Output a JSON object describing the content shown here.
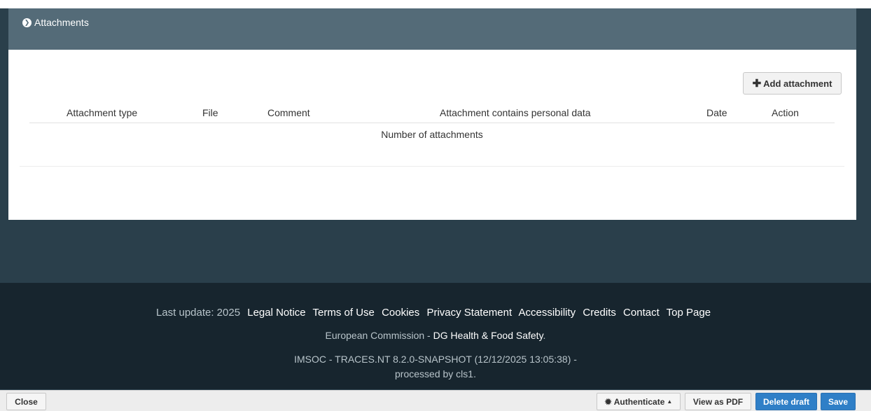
{
  "section": {
    "title": "Attachments"
  },
  "attachments": {
    "add_button_label": "Add attachment",
    "columns": [
      "Attachment type",
      "File",
      "Comment",
      "Attachment contains personal data",
      "Date",
      "Action"
    ],
    "summary_label": "Number of attachments"
  },
  "footer": {
    "last_update": "Last update: 2025",
    "links": [
      "Legal Notice",
      "Terms of Use",
      "Cookies",
      "Privacy Statement",
      "Accessibility",
      "Credits",
      "Contact",
      "Top Page"
    ],
    "ec_prefix": "European Commission - ",
    "ec_link": "DG Health & Food Safety",
    "ec_suffix": ".",
    "version_line1": "IMSOC - TRACES.NT 8.2.0-SNAPSHOT (12/12/2025 13:05:38) -",
    "version_line2": "processed by cls1."
  },
  "actions": {
    "close": "Close",
    "authenticate": "Authenticate",
    "view_pdf": "View as PDF",
    "delete_draft": "Delete draft",
    "save": "Save"
  },
  "colors": {
    "header": "#546b78",
    "page_bg": "#2a3f4b",
    "footer_bg": "#17252e",
    "primary": "#2f7fc7"
  }
}
